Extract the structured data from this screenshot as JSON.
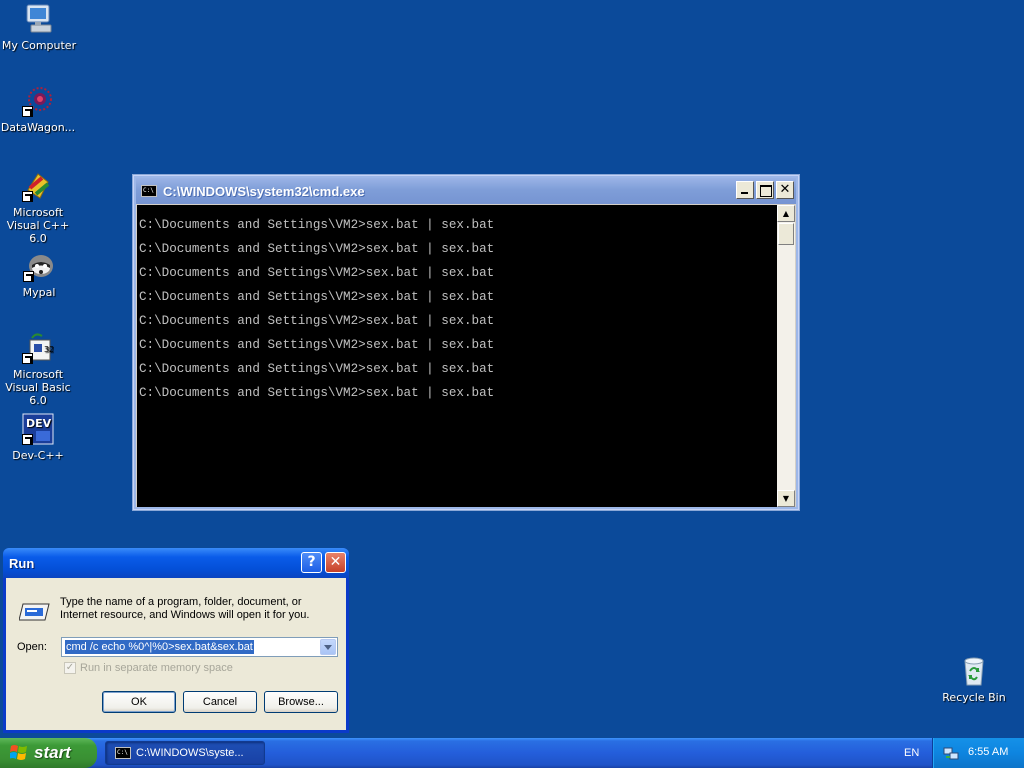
{
  "desktop": {
    "background_color": "#0b4a9a",
    "icons": [
      {
        "label": "My Computer",
        "icon": "my-computer-icon"
      },
      {
        "label": "DataWagon...",
        "icon": "datawagon-icon"
      },
      {
        "label": "Microsoft Visual C++ 6.0",
        "icon": "visual-cpp-icon"
      },
      {
        "label": "Mypal",
        "icon": "mypal-icon"
      },
      {
        "label": "Microsoft Visual Basic 6.0",
        "icon": "visual-basic-icon"
      },
      {
        "label": "Dev-C++",
        "icon": "dev-cpp-icon"
      }
    ],
    "recycle_bin": {
      "label": "Recycle Bin",
      "icon": "recycle-bin-icon"
    }
  },
  "cmd_window": {
    "title": "C:\\WINDOWS\\system32\\cmd.exe",
    "lines": [
      "C:\\Documents and Settings\\VM2>sex.bat | sex.bat",
      "C:\\Documents and Settings\\VM2>sex.bat | sex.bat",
      "C:\\Documents and Settings\\VM2>sex.bat | sex.bat",
      "C:\\Documents and Settings\\VM2>sex.bat | sex.bat",
      "C:\\Documents and Settings\\VM2>sex.bat | sex.bat",
      "C:\\Documents and Settings\\VM2>sex.bat | sex.bat",
      "C:\\Documents and Settings\\VM2>sex.bat | sex.bat",
      "C:\\Documents and Settings\\VM2>sex.bat | sex.bat"
    ],
    "icon_text": "C:\\",
    "close_glyph": "✕"
  },
  "run_dialog": {
    "title": "Run",
    "help_glyph": "?",
    "close_glyph": "✕",
    "description": "Type the name of a program, folder, document, or Internet resource, and Windows will open it for you.",
    "open_label": "Open:",
    "open_value": "cmd /c echo %0^|%0>sex.bat&sex.bat",
    "checkbox_label": "Run in separate memory space",
    "checkbox_checked": true,
    "ok_label": "OK",
    "cancel_label": "Cancel",
    "browse_label": "Browse..."
  },
  "taskbar": {
    "start_label": "start",
    "task_item_label": "C:\\WINDOWS\\syste...",
    "language": "EN",
    "clock": "6:55 AM"
  }
}
